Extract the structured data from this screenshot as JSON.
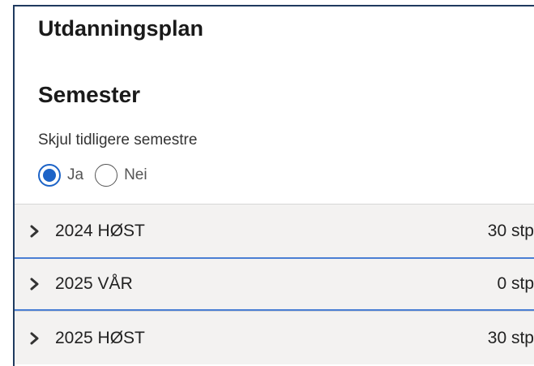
{
  "page": {
    "title": "Utdanningsplan"
  },
  "semester_section": {
    "title": "Semester",
    "hide_previous_label": "Skjul tidligere semestre",
    "options": [
      {
        "label": "Ja",
        "checked": true
      },
      {
        "label": "Nei",
        "checked": false
      }
    ]
  },
  "semesters": [
    {
      "name": "2024 HØST",
      "credits": "30 stp",
      "focused": false
    },
    {
      "name": "2025 VÅR",
      "credits": "0 stp",
      "focused": true
    },
    {
      "name": "2025 HØST",
      "credits": "30 stp",
      "focused": false
    }
  ],
  "colors": {
    "accent": "#1c63c7",
    "focus_border": "#4a7fd4",
    "row_background": "#f3f2f1",
    "frame_border": "#1f3a5f"
  },
  "icons": {
    "row_expander": "chevron-right-icon"
  }
}
